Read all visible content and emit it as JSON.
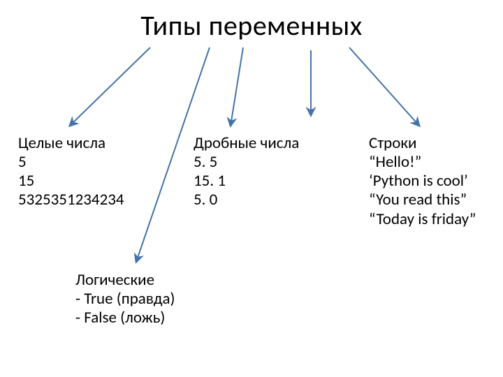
{
  "title": "Типы переменных",
  "integers": {
    "heading": "Целые числа",
    "v1": "5",
    "v2": "15",
    "v3": "5325351234234"
  },
  "floats": {
    "heading": "Дробные числа",
    "v1": "5. 5",
    "v2": "15. 1",
    "v3": "5. 0"
  },
  "strings": {
    "heading": "Строки",
    "v1": "“Hello!”",
    "v2": "‘Python is cool’",
    "v3": "“You read this”",
    "v4": "“Today is friday”"
  },
  "booleans": {
    "heading": "Логические",
    "v1": "- True (правда)",
    "v2": "- False (ложь)"
  },
  "arrow_color": "#4573a7"
}
